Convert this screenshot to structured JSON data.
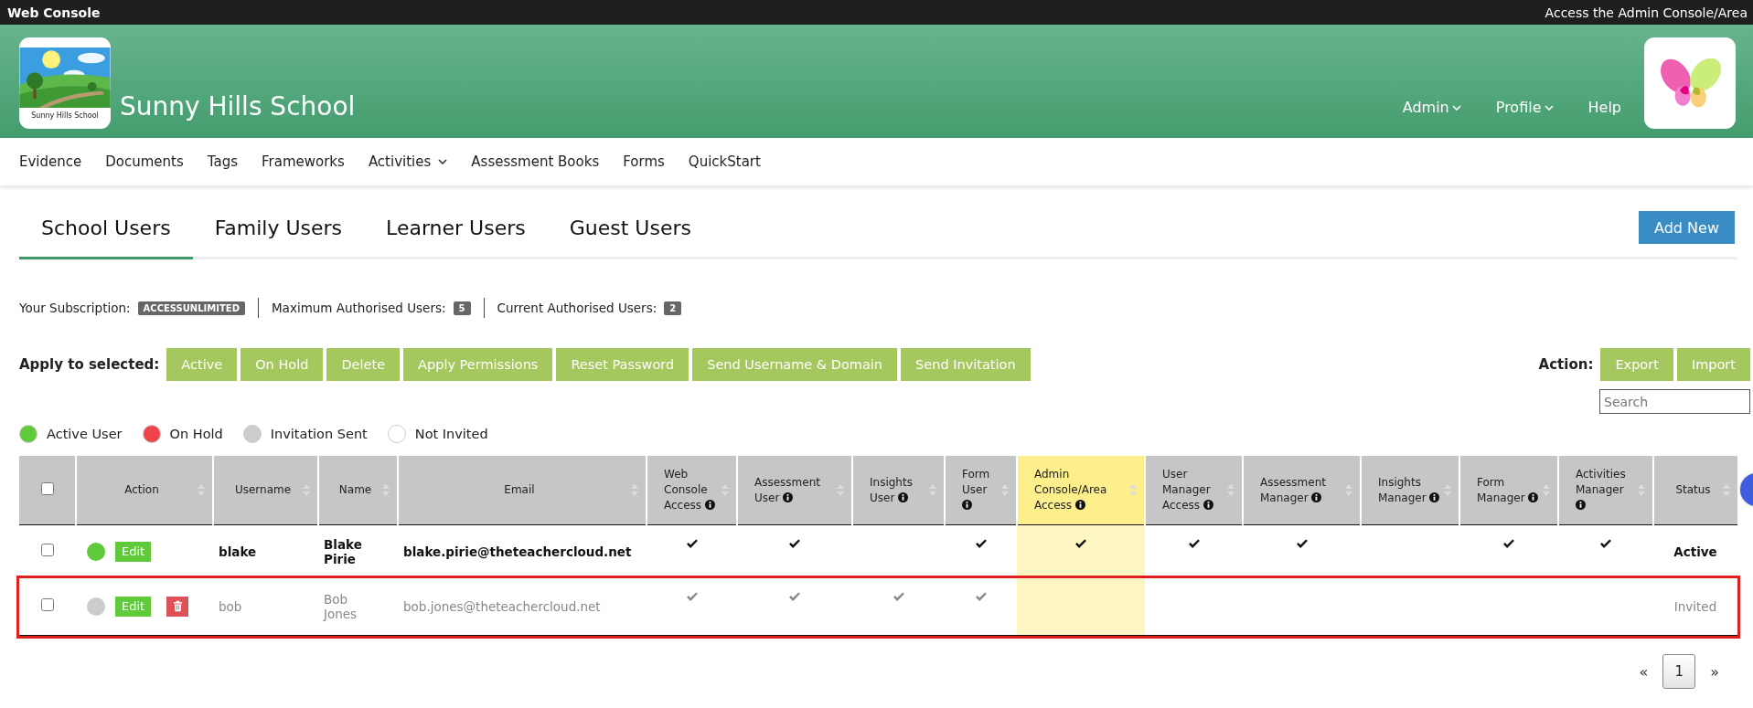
{
  "top_bar": {
    "title": "Web Console",
    "link": "Access the Admin Console/Area"
  },
  "header": {
    "school_name": "Sunny Hills School",
    "logo_caption": "Sunny Hills School",
    "menu": [
      {
        "label": "Admin",
        "dropdown": true
      },
      {
        "label": "Profile",
        "dropdown": true
      },
      {
        "label": "Help",
        "dropdown": false
      }
    ]
  },
  "nav": [
    {
      "label": "Evidence",
      "dropdown": false
    },
    {
      "label": "Documents",
      "dropdown": false
    },
    {
      "label": "Tags",
      "dropdown": false
    },
    {
      "label": "Frameworks",
      "dropdown": false
    },
    {
      "label": "Activities",
      "dropdown": true
    },
    {
      "label": "Assessment Books",
      "dropdown": false
    },
    {
      "label": "Forms",
      "dropdown": false
    },
    {
      "label": "QuickStart",
      "dropdown": false
    }
  ],
  "tabs": [
    {
      "label": "School Users",
      "selected": true
    },
    {
      "label": "Family Users",
      "selected": false
    },
    {
      "label": "Learner Users",
      "selected": false
    },
    {
      "label": "Guest Users",
      "selected": false
    }
  ],
  "add_button": "Add New",
  "subscription": [
    {
      "label": "Your Subscription:",
      "value": "ACCESSUNLIMITED"
    },
    {
      "label": "Maximum Authorised Users:",
      "value": "5"
    },
    {
      "label": "Current Authorised Users:",
      "value": "2"
    }
  ],
  "bulk_actions": {
    "label": "Apply to selected:",
    "buttons": [
      "Active",
      "On Hold",
      "Delete",
      "Apply Permissions",
      "Reset Password",
      "Send Username & Domain",
      "Send Invitation"
    ]
  },
  "actions": {
    "label": "Action:",
    "buttons": [
      "Export",
      "Import"
    ]
  },
  "search": {
    "placeholder": "Search"
  },
  "legend": [
    {
      "label": "Active User",
      "color": "#5fcb3a"
    },
    {
      "label": "On Hold",
      "color": "#f2434a"
    },
    {
      "label": "Invitation Sent",
      "color": "#cccccc"
    },
    {
      "label": "Not Invited",
      "color": "#ffffff"
    }
  ],
  "table": {
    "select_all_checked": false,
    "columns": [
      {
        "label": "Action",
        "info": false,
        "highlighted": false,
        "kind": "action"
      },
      {
        "label": "Username",
        "info": false,
        "highlighted": false,
        "kind": "username"
      },
      {
        "label": "Name",
        "info": false,
        "highlighted": false,
        "kind": "name"
      },
      {
        "label": "Email",
        "info": false,
        "highlighted": false,
        "kind": "email"
      },
      {
        "label": "Web Console Access",
        "info": true,
        "highlighted": false,
        "kind": "permission"
      },
      {
        "label": "Assessment User",
        "info": true,
        "highlighted": false,
        "kind": "permission"
      },
      {
        "label": "Insights User",
        "info": true,
        "highlighted": false,
        "kind": "permission"
      },
      {
        "label": "Form User",
        "info": true,
        "highlighted": false,
        "kind": "permission"
      },
      {
        "label": "Admin Console/Area Access",
        "info": true,
        "highlighted": true,
        "kind": "permission"
      },
      {
        "label": "User Manager Access",
        "info": true,
        "highlighted": false,
        "kind": "permission"
      },
      {
        "label": "Assessment Manager",
        "info": true,
        "highlighted": false,
        "kind": "permission"
      },
      {
        "label": "Insights Manager",
        "info": true,
        "highlighted": false,
        "kind": "permission"
      },
      {
        "label": "Form Manager",
        "info": true,
        "highlighted": false,
        "kind": "permission"
      },
      {
        "label": "Activities Manager",
        "info": true,
        "highlighted": false,
        "kind": "permission"
      },
      {
        "label": "Status",
        "info": false,
        "highlighted": false,
        "kind": "status"
      }
    ],
    "rows": [
      {
        "checked": false,
        "color": "#5fcb3a",
        "edit": "Edit",
        "deletable": false,
        "username": "blake",
        "name": "Blake Pirie",
        "email": "blake.pirie@theteachercloud.net",
        "permissions": [
          true,
          true,
          false,
          true,
          true,
          true,
          true,
          false,
          true,
          true
        ],
        "status": "Active",
        "dimmed": false,
        "outlined": false
      },
      {
        "checked": false,
        "color": "#cccccc",
        "edit": "Edit",
        "deletable": true,
        "username": "bob",
        "name": "Bob Jones",
        "email": "bob.jones@theteachercloud.net",
        "permissions": [
          true,
          true,
          true,
          true,
          false,
          false,
          false,
          false,
          false,
          false
        ],
        "status": "Invited",
        "dimmed": true,
        "outlined": true
      }
    ]
  },
  "pagination": {
    "prev": "«",
    "pages": [
      {
        "label": "1",
        "selected": true
      }
    ],
    "next": "»"
  }
}
